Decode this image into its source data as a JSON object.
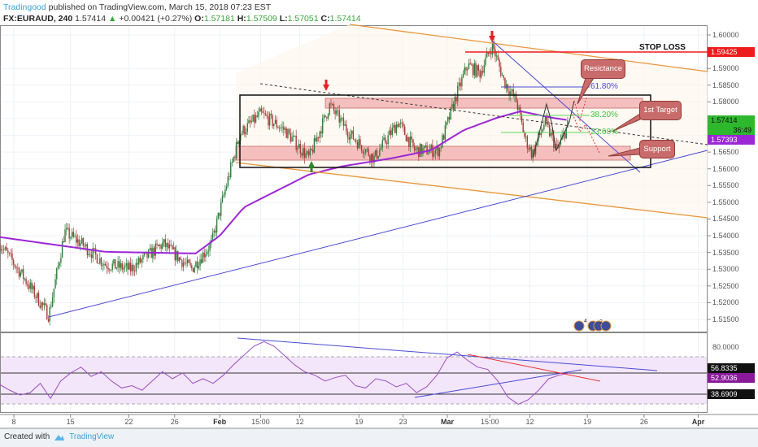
{
  "header": {
    "author": "Tradingood",
    "published": "published on TradingView.com, March 15, 2018 07:23 EST",
    "symbol": "FX:EURAUD, 240",
    "last": "1.57414",
    "change": "+0.00421 (+0.27%)",
    "open_label": "O:",
    "open": "1.57181",
    "high_label": "H:",
    "high": "1.57509",
    "low_label": "L:",
    "low": "1.57051",
    "close_label": "C:",
    "close": "1.57414"
  },
  "annotations": {
    "stop_loss": "STOP LOSS",
    "resistance": "Resictance",
    "first_target": "1st Target",
    "support": "Support",
    "fib_618": "61.80%",
    "fib_382": "38.20%",
    "fib_236": "23.60%",
    "event_count_1": "4",
    "event_count_2": "2"
  },
  "badges": {
    "stop_loss_price": "1.59425",
    "last_price": "1.57414",
    "countdown": "36:49",
    "ma_value": "1.57393",
    "rsi_upper": "56.8335",
    "rsi_value": "52.9036",
    "rsi_lower": "38.6909"
  },
  "colors": {
    "up": "#2f7d3a",
    "down": "#a83a3a",
    "ma": "#9b27d6",
    "rsi": "#9b4fc0",
    "stop": "#ee1c1c",
    "channel": "#e8963c",
    "trend": "#4a4ad6"
  },
  "footer": {
    "created_with": "Created with",
    "brand": "TradingView"
  },
  "chart_data": {
    "type": "candlestick",
    "title": "FX:EURAUD, 240",
    "price_axis": {
      "ticks": [
        "1.60000",
        "1.59000",
        "1.58500",
        "1.58000",
        "1.57500",
        "1.57000",
        "1.56500",
        "1.56000",
        "1.55500",
        "1.55000",
        "1.54500",
        "1.54000",
        "1.53500",
        "1.53000",
        "1.52500",
        "1.52000",
        "1.51500"
      ],
      "range": [
        1.513,
        1.603
      ]
    },
    "time_axis": [
      {
        "label": "8",
        "day": 0
      },
      {
        "label": "15",
        "day": 6.8
      },
      {
        "label": "22",
        "day": 13.8
      },
      {
        "label": "26",
        "day": 19.3
      },
      {
        "label": "Feb",
        "day": 24.7,
        "bold": true
      },
      {
        "label": "15:00",
        "day": 29.6
      },
      {
        "label": "12",
        "day": 34.3
      },
      {
        "label": "19",
        "day": 41.4
      },
      {
        "label": "23",
        "day": 46.7
      },
      {
        "label": "Mar",
        "day": 52,
        "bold": true
      },
      {
        "label": "15:00",
        "day": 57.1
      },
      {
        "label": "12",
        "day": 61.9
      },
      {
        "label": "19",
        "day": 68.8
      },
      {
        "label": "26",
        "day": 75.6
      },
      {
        "label": "Apr",
        "day": 82.1,
        "bold": true
      }
    ],
    "price_path": [
      [
        -1.7,
        1.5376
      ],
      [
        0.8,
        1.529
      ],
      [
        4.2,
        1.5162
      ],
      [
        6.1,
        1.5412
      ],
      [
        8.1,
        1.5376
      ],
      [
        11,
        1.5315
      ],
      [
        14,
        1.53
      ],
      [
        17.9,
        1.5376
      ],
      [
        21.3,
        1.53
      ],
      [
        23.7,
        1.5376
      ],
      [
        25.7,
        1.557
      ],
      [
        27.1,
        1.5704
      ],
      [
        29.6,
        1.5764
      ],
      [
        32.5,
        1.5716
      ],
      [
        35.4,
        1.5631
      ],
      [
        37.9,
        1.579
      ],
      [
        40.3,
        1.5704
      ],
      [
        43.2,
        1.5631
      ],
      [
        46.1,
        1.574
      ],
      [
        48.1,
        1.5655
      ],
      [
        51,
        1.5655
      ],
      [
        53,
        1.5813
      ],
      [
        54.4,
        1.591
      ],
      [
        55.9,
        1.5886
      ],
      [
        57.4,
        1.597
      ],
      [
        58.8,
        1.5862
      ],
      [
        60.3,
        1.5801
      ],
      [
        61.3,
        1.5692
      ],
      [
        62.2,
        1.5643
      ],
      [
        63.7,
        1.574
      ],
      [
        65.2,
        1.5655
      ],
      [
        66.6,
        1.5741
      ]
    ],
    "moving_average": [
      [
        -1.7,
        1.5396
      ],
      [
        11,
        1.5352
      ],
      [
        21.8,
        1.5347
      ],
      [
        24.7,
        1.54
      ],
      [
        27.6,
        1.5485
      ],
      [
        31.5,
        1.5534
      ],
      [
        35.4,
        1.5583
      ],
      [
        39.3,
        1.5607
      ],
      [
        45.2,
        1.5631
      ],
      [
        50,
        1.5655
      ],
      [
        54,
        1.5716
      ],
      [
        57.9,
        1.5752
      ],
      [
        60.8,
        1.5772
      ],
      [
        64.7,
        1.5752
      ],
      [
        66.6,
        1.5745
      ]
    ],
    "rsi": {
      "axis_label": "80.0000",
      "range_days": [
        -1.7,
        66.6
      ],
      "values": [
        47,
        42,
        38,
        40,
        48,
        35,
        50,
        57,
        62,
        54,
        58,
        50,
        44,
        46,
        42,
        50,
        58,
        52,
        57,
        48,
        52,
        48,
        55,
        64,
        72,
        80,
        84,
        80,
        72,
        64,
        58,
        55,
        50,
        53,
        55,
        46,
        44,
        52,
        50,
        45,
        48,
        40,
        45,
        55,
        70,
        75,
        68,
        62,
        60,
        50,
        36,
        30,
        34,
        42,
        52,
        55,
        57
      ],
      "bands": [
        70,
        30
      ]
    }
  }
}
